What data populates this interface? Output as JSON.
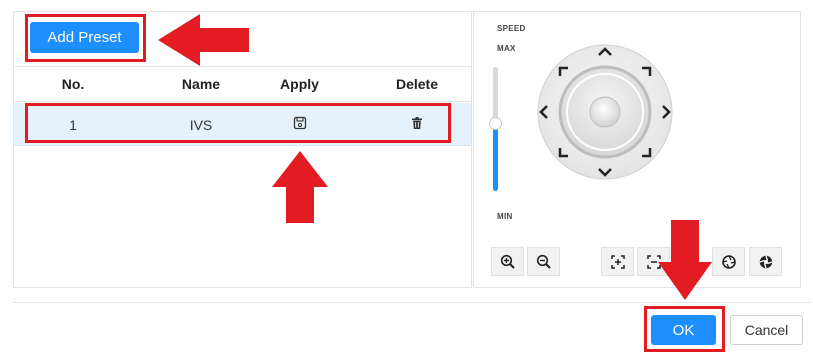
{
  "toolbar": {
    "add_preset_label": "Add Preset"
  },
  "table": {
    "headers": {
      "no": "No.",
      "name": "Name",
      "apply": "Apply",
      "delete": "Delete"
    },
    "rows": [
      {
        "no": "1",
        "name": "IVS"
      }
    ]
  },
  "ptz": {
    "speed_label": "SPEED",
    "max_label": "MAX",
    "min_label": "MIN",
    "speed_level": 0.55
  },
  "footer": {
    "ok_label": "OK",
    "cancel_label": "Cancel"
  },
  "colors": {
    "accent": "#1e8fff",
    "annotation": "#e31b23",
    "row_selected": "#e6f2fb"
  },
  "icons": [
    "save-icon",
    "trash-icon",
    "zoom-in-icon",
    "zoom-out-icon",
    "focus-near-icon",
    "focus-far-icon",
    "iris-open-icon",
    "iris-close-icon"
  ]
}
